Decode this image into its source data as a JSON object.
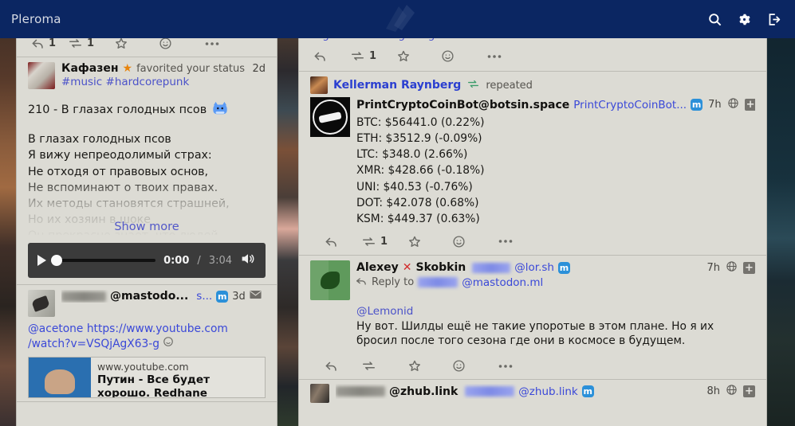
{
  "app": {
    "title": "Pleroma",
    "header_bg": "#0b2662",
    "column_bg": "#dcdbd4",
    "link_color": "#3a48d8"
  },
  "header": {
    "brand": "Pleroma",
    "icons": [
      {
        "name": "search-icon",
        "label": "Search"
      },
      {
        "name": "gear-icon",
        "label": "Settings"
      },
      {
        "name": "logout-icon",
        "label": "Log out"
      }
    ]
  },
  "left_column": {
    "top_actions": {
      "reply_count": "1",
      "repeat_count": "1",
      "favorite_count": "",
      "emoji": "",
      "more": ""
    },
    "post": {
      "author": "Кафазен",
      "favorited_text": "favorited your status",
      "timestamp": "2d",
      "hashtags": "#music #hardcorepunk",
      "title": "210 - В глазах голодных псов",
      "poem_lines": [
        "В глазах голодных псов",
        "Я вижу непреодолимый страх:",
        "Не отходя от правовых основ,",
        "Не вспоминают о твоих правах.",
        "Их методы становятся страшней,",
        "Но их хозяин в шоке",
        "Он прекрасно знает, что людей"
      ],
      "show_more": "Show more",
      "audio": {
        "current_time": "0:00",
        "separator": "/",
        "total_time": "3:04"
      }
    },
    "post2": {
      "display_name_redacted": "schmuck",
      "handle": "@mastodo...",
      "source_link": "s...",
      "network_icon": "mastodon-icon",
      "timestamp": "3d",
      "envelope_icon": "envelope-icon",
      "body_mention": "@acetone",
      "body_link_1": "https://www.youtube.com",
      "body_link_2": "/watch?v=VSQjAgX63-g",
      "card": {
        "url": "www.youtube.com",
        "title": "Путин - Все будет хорошо. Redhane"
      }
    }
  },
  "right_column": {
    "top_post_tail": {
      "hashtags": "#go #haskell #golang",
      "actions": {
        "reply_count": "",
        "repeat_count": "1"
      }
    },
    "post_crypto": {
      "repeater_name": "Kellerman Raynberg",
      "repeated_label": "repeated",
      "handle_bold": "PrintCryptoCoinBot@botsin.space",
      "handle_link": "PrintCryptoCoinBot...",
      "network_icon": "mastodon-icon",
      "timestamp": "7h",
      "globe_icon": "globe-icon",
      "expand_icon": "expand-icon",
      "lines": [
        "BTC: $56441.0 (0.22%)",
        "ETH: $3512.9 (-0.09%)",
        "LTC: $348.0 (2.66%)",
        "XMR: $428.66 (-0.18%)",
        "UNI: $40.53 (-0.76%)",
        "DOT: $42.078 (0.68%)",
        "KSM: $449.37 (0.63%)"
      ],
      "actions": {
        "reply_count": "",
        "repeat_count": "1"
      }
    },
    "post_skobkin": {
      "name_part1": "Alexey",
      "name_x": "✕",
      "name_part2": "Skobkin",
      "handle_redacted": "skobkin",
      "handle": "@lor.sh",
      "network_icon": "mastodon-icon",
      "timestamp": "7h",
      "globe_icon": "globe-icon",
      "expand_icon": "expand-icon",
      "reply_to_label": "Reply to",
      "reply_to_redacted": "Lemonid",
      "reply_to_handle": "@mastodon.ml",
      "mention": "@Lemonid",
      "body": "Ну вот. Шилды ещё не такие упоротые в этом плане. Но я их бросил после того сезона где они в космосе в будущем.",
      "actions": {
        "reply_count": "",
        "repeat_count": ""
      }
    },
    "post_zhub": {
      "name_redacted": "fantomas",
      "handle_bold": "@zhub.link",
      "handle_redacted": "fantomas",
      "handle_link": "@zhub.link",
      "network_icon": "mastodon-icon",
      "timestamp": "8h",
      "globe_icon": "globe-icon",
      "expand_icon": "expand-icon"
    }
  }
}
